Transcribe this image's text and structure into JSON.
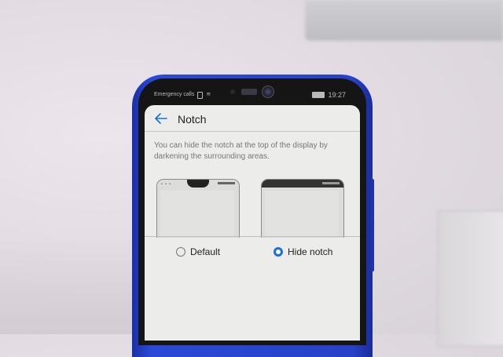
{
  "status_bar": {
    "carrier": "Emergency calls",
    "time": "19:27"
  },
  "header": {
    "title": "Notch",
    "back_icon": "arrow-left-icon"
  },
  "description": "You can hide the notch at the top of the display by darkening the surrounding areas.",
  "options": [
    {
      "label": "Default",
      "selected": false
    },
    {
      "label": "Hide notch",
      "selected": true
    }
  ],
  "colors": {
    "accent": "#1a6fe0",
    "phone_body": "#2741c8"
  }
}
